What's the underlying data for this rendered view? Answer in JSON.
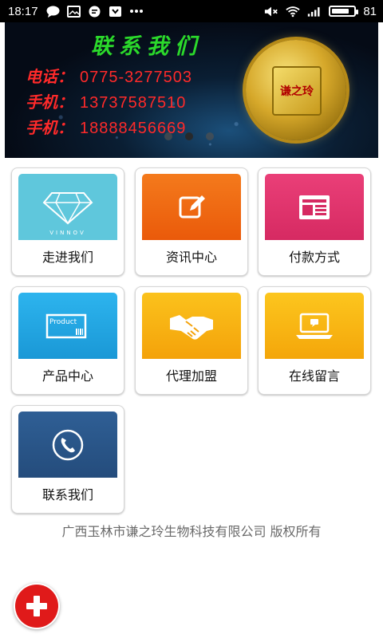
{
  "status_bar": {
    "time": "18:17",
    "left_icons": [
      "chat-bubble-icon",
      "image-mail-icon",
      "message-icon",
      "download-icon",
      "more-dots-icon"
    ],
    "right_icons": [
      "mute-icon",
      "wifi-icon",
      "signal-icon"
    ],
    "battery_level": 81,
    "battery_text": "81"
  },
  "banner": {
    "title": "联系我们",
    "lines": [
      {
        "label": "电话：",
        "number": "0775-3277503"
      },
      {
        "label": "手机：",
        "number": "13737587510"
      },
      {
        "label": "手机：",
        "number": "18888456669"
      }
    ],
    "coin_text": "谦之玲",
    "slides": 3,
    "active_slide": 2
  },
  "menu": {
    "tiles": [
      {
        "label": "走进我们",
        "icon": "diamond-icon",
        "color": "#5fc7dc",
        "caption": "VINNOV"
      },
      {
        "label": "资讯中心",
        "icon": "edit-icon",
        "color": "#f06a12"
      },
      {
        "label": "付款方式",
        "icon": "newspaper-icon",
        "color": "#e3336e"
      },
      {
        "label": "产品中心",
        "icon": "product-box-icon",
        "color": "#1ea6e0",
        "caption": "Product"
      },
      {
        "label": "代理加盟",
        "icon": "handshake-icon",
        "color": "#f7b10a"
      },
      {
        "label": "在线留言",
        "icon": "laptop-chat-icon",
        "color": "#f7b80a"
      },
      {
        "label": "联系我们",
        "icon": "phone-icon",
        "color": "#2b5a8e"
      }
    ]
  },
  "footer": {
    "text": "广西玉林市谦之玲生物科技有限公司 版权所有"
  },
  "fab": {
    "icon": "plus-icon",
    "color": "#e01a1a"
  }
}
